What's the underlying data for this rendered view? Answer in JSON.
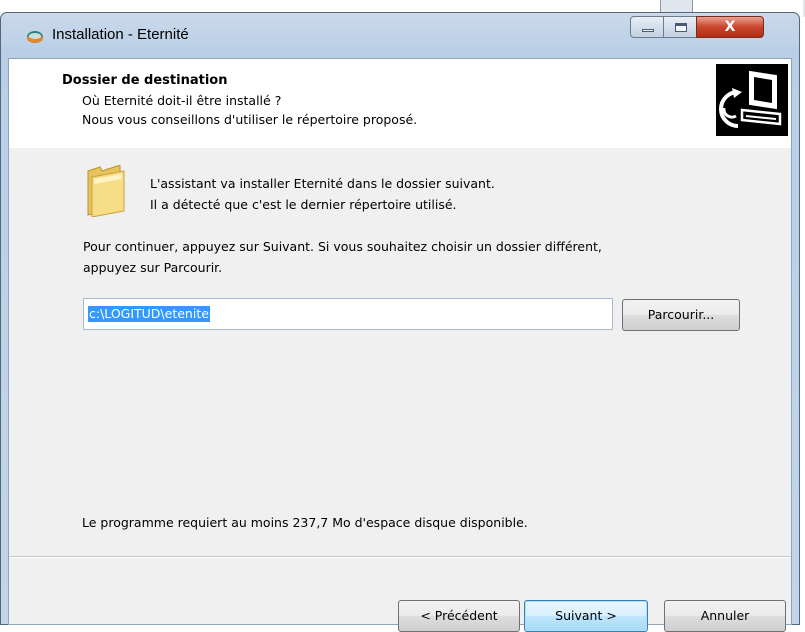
{
  "window": {
    "title": "Installation - Eternité",
    "close_glyph": "X"
  },
  "header": {
    "title": "Dossier de destination",
    "subtitle1": "Où Eternité doit-il être installé ?",
    "subtitle2": "Nous vous conseillons d'utiliser le répertoire proposé."
  },
  "body": {
    "intro_line1": "L'assistant va installer Eternité dans le dossier suivant.",
    "intro_line2": "Il a détecté que c'est le dernier répertoire utilisé.",
    "instruction_line1": "Pour continuer, appuyez sur Suivant. Si vous souhaitez choisir un dossier différent,",
    "instruction_line2": "appuyez sur Parcourir.",
    "path_value": "c:\\LOGITUD\\etenite",
    "browse_label": "Parcourir...",
    "space_text": "Le programme requiert au moins 237,7 Mo d'espace disque disponible."
  },
  "footer": {
    "prev_label": "< Précédent",
    "next_label": "Suivant >",
    "cancel_label": "Annuler"
  },
  "icons": {
    "app": "setup-icon",
    "header": "install-computer-icon",
    "folder": "folder-icon"
  },
  "colors": {
    "selection": "#3399ff",
    "close_button": "#c9452c",
    "frame": "#b9cfe7"
  }
}
